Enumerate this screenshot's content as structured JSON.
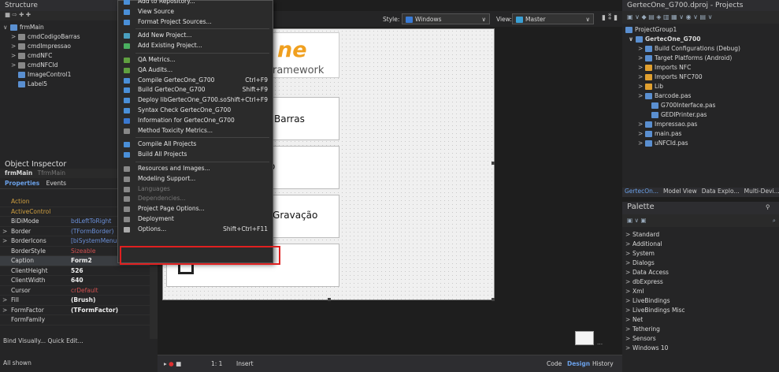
{
  "structure": {
    "title": "Structure",
    "root": "frmMain",
    "items": [
      "cmdCodigoBarras",
      "cmdImpressao",
      "cmdNFC",
      "cmdNFCId",
      "ImageControl1",
      "Label5"
    ]
  },
  "object_inspector": {
    "title": "Object Inspector",
    "form_name": "frmMain",
    "form_type": "TfrmMain",
    "tab_properties": "Properties",
    "tab_events": "Events",
    "rows": [
      {
        "name": "Action",
        "value": ""
      },
      {
        "name": "ActiveControl",
        "value": ""
      },
      {
        "name": "BiDiMode",
        "value": "bdLeftToRight"
      },
      {
        "name": "Border",
        "value": "(TFormBorder)"
      },
      {
        "name": "BorderIcons",
        "value": "[biSystemMenu,bi"
      },
      {
        "name": "BorderStyle",
        "value": "Sizeable"
      },
      {
        "name": "Caption",
        "value": "Form2"
      },
      {
        "name": "ClientHeight",
        "value": "526"
      },
      {
        "name": "ClientWidth",
        "value": "640"
      },
      {
        "name": "Cursor",
        "value": "crDefault"
      },
      {
        "name": "Fill",
        "value": "(Brush)"
      },
      {
        "name": "FormFactor",
        "value": "(TFormFactor)"
      },
      {
        "name": "FormFamily",
        "value": ""
      }
    ],
    "bind_text": "Bind Visually... Quick Edit...",
    "status": "All shown"
  },
  "toolbar": {
    "style_label": "Style:",
    "style_value": "Windows",
    "view_label": "View:",
    "view_value": "Master"
  },
  "form_cards": {
    "logo_text": "ne",
    "framework_text": "ramework",
    "card1": "Barras",
    "card2": "o",
    "card3": "/Gravação"
  },
  "bottom_bar": {
    "position": "1: 1",
    "mode": "Insert",
    "tab_code": "Code",
    "tab_design": "Design",
    "tab_history": "History"
  },
  "menu": {
    "items": [
      {
        "label": "Add to Repository...",
        "shortcut": ""
      },
      {
        "label": "View Source",
        "shortcut": ""
      },
      {
        "label": "Format Project Sources...",
        "shortcut": ""
      },
      {
        "sep": true
      },
      {
        "label": "Add New Project...",
        "shortcut": ""
      },
      {
        "label": "Add Existing Project...",
        "shortcut": ""
      },
      {
        "sep": true
      },
      {
        "label": "QA Metrics...",
        "shortcut": ""
      },
      {
        "label": "QA Audits...",
        "shortcut": ""
      },
      {
        "label": "Compile GertecOne_G700",
        "shortcut": "Ctrl+F9"
      },
      {
        "label": "Build GertecOne_G700",
        "shortcut": "Shift+F9"
      },
      {
        "label": "Deploy libGertecOne_G700.so",
        "shortcut": "Shift+Ctrl+F9"
      },
      {
        "label": "Syntax Check GertecOne_G700",
        "shortcut": ""
      },
      {
        "label": "Information for GertecOne_G700",
        "shortcut": ""
      },
      {
        "label": "Method Toxicity Metrics...",
        "shortcut": ""
      },
      {
        "sep": true
      },
      {
        "label": "Compile All Projects",
        "shortcut": ""
      },
      {
        "label": "Build All Projects",
        "shortcut": ""
      },
      {
        "sep": true
      },
      {
        "label": "Resources and Images...",
        "shortcut": ""
      },
      {
        "label": "Modeling Support...",
        "shortcut": ""
      },
      {
        "label": "Languages",
        "shortcut": "",
        "disabled": true
      },
      {
        "label": "Dependencies...",
        "shortcut": "",
        "disabled": true
      },
      {
        "label": "Project Page Options...",
        "shortcut": ""
      },
      {
        "label": "Deployment",
        "shortcut": ""
      },
      {
        "label": "Options...",
        "shortcut": "Shift+Ctrl+F11"
      }
    ]
  },
  "projects": {
    "title": "GertecOne_G700.dproj - Projects",
    "group": "ProjectGroup1",
    "project": "GertecOne_G700",
    "items": [
      {
        "label": "Build Configurations (Debug)",
        "indent": 2
      },
      {
        "label": "Target Platforms (Android)",
        "indent": 2
      },
      {
        "label": "Imports NFC",
        "indent": 2
      },
      {
        "label": "Imports NFC700",
        "indent": 2
      },
      {
        "label": "Lib",
        "indent": 2
      },
      {
        "label": "Barcode.pas",
        "indent": 2
      },
      {
        "label": "G700Interface.pas",
        "indent": 3
      },
      {
        "label": "GEDIPrinter.pas",
        "indent": 3
      },
      {
        "label": "Impressao.pas",
        "indent": 2
      },
      {
        "label": "main.pas",
        "indent": 2
      },
      {
        "label": "uNFCId.pas",
        "indent": 2
      }
    ],
    "tabs": [
      "GertecOn...",
      "Model View",
      "Data Explo...",
      "Multi-Devi..."
    ]
  },
  "palette": {
    "title": "Palette",
    "items": [
      "Standard",
      "Additional",
      "System",
      "Dialogs",
      "Data Access",
      "dbExpress",
      "Xml",
      "LiveBindings",
      "LiveBindings Misc",
      "Net",
      "Tethering",
      "Sensors",
      "Windows 10"
    ]
  }
}
